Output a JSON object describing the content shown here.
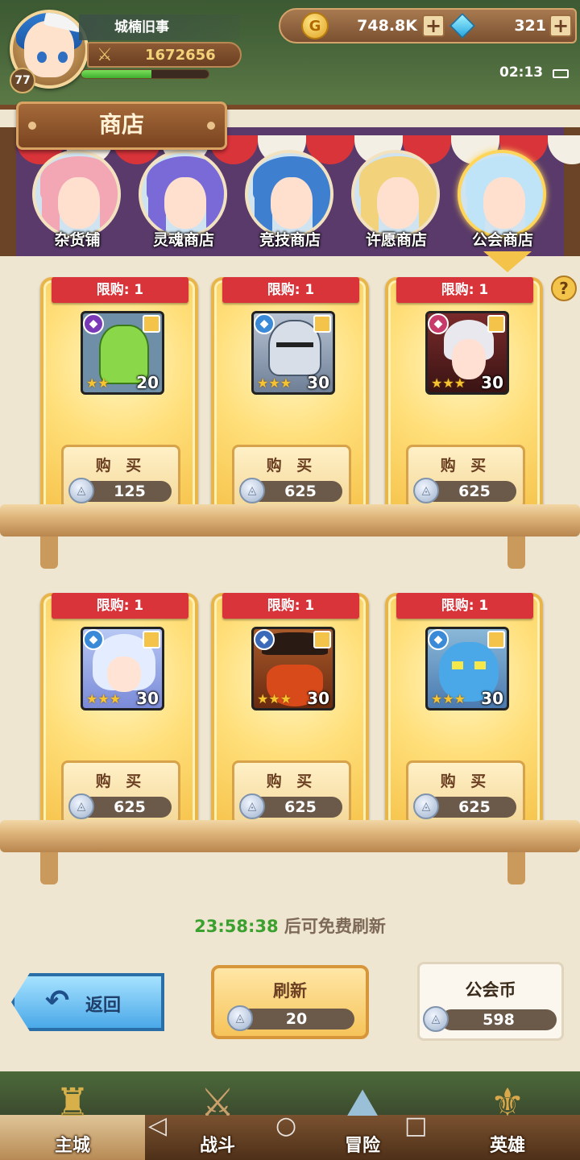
{
  "player": {
    "name": "城楠旧事",
    "level": "77",
    "power": "1672656",
    "exp_progress": 0.55
  },
  "resources": {
    "gold": "748.8K",
    "gems": "321",
    "gold_icon": "G"
  },
  "status": {
    "time": "02:13"
  },
  "shop": {
    "title": "商店",
    "tabs": [
      {
        "label": "杂货铺",
        "hair": "#f3a6b4",
        "active": false
      },
      {
        "label": "灵魂商店",
        "hair": "#7a6ad8",
        "active": false
      },
      {
        "label": "竞技商店",
        "hair": "#3e7fd0",
        "active": false
      },
      {
        "label": "许愿商店",
        "hair": "#f2d27a",
        "active": false
      },
      {
        "label": "公会商店",
        "hair": "#bfe4f7",
        "active": true
      }
    ],
    "help": "?",
    "items": [
      {
        "limit": "限购: 1",
        "qty": "20",
        "stars": "★★",
        "buy": "购 买",
        "price": "125",
        "faction_color": "#7a3ab8",
        "art": "green-helmet"
      },
      {
        "limit": "限购: 1",
        "qty": "30",
        "stars": "★★★",
        "buy": "购 买",
        "price": "625",
        "faction_color": "#3a8ad8",
        "art": "armored-knight"
      },
      {
        "limit": "限购: 1",
        "qty": "30",
        "stars": "★★★",
        "buy": "购 买",
        "price": "625",
        "faction_color": "#c83a6a",
        "art": "white-hair-woman"
      },
      {
        "limit": "限购: 1",
        "qty": "30",
        "stars": "★★★",
        "buy": "购 买",
        "price": "625",
        "faction_color": "#3a8ad8",
        "art": "hooded-mage"
      },
      {
        "limit": "限购: 1",
        "qty": "30",
        "stars": "★★★",
        "buy": "购 买",
        "price": "625",
        "faction_color": "#3a6ab8",
        "art": "red-beard-pirate"
      },
      {
        "limit": "限购: 1",
        "qty": "30",
        "stars": "★★★",
        "buy": "购 买",
        "price": "625",
        "faction_color": "#3a8ad8",
        "art": "blue-monster"
      }
    ]
  },
  "refresh": {
    "timer": "23:58:38",
    "timer_text": " 后可免费刷新",
    "button_label": "刷新",
    "price": "20"
  },
  "back": {
    "label": "返回"
  },
  "guild_coins": {
    "label": "公会币",
    "value": "598"
  },
  "nav": [
    {
      "label": "主城",
      "active": true
    },
    {
      "label": "战斗",
      "active": false
    },
    {
      "label": "冒险",
      "active": false
    },
    {
      "label": "英雄",
      "active": false
    }
  ]
}
